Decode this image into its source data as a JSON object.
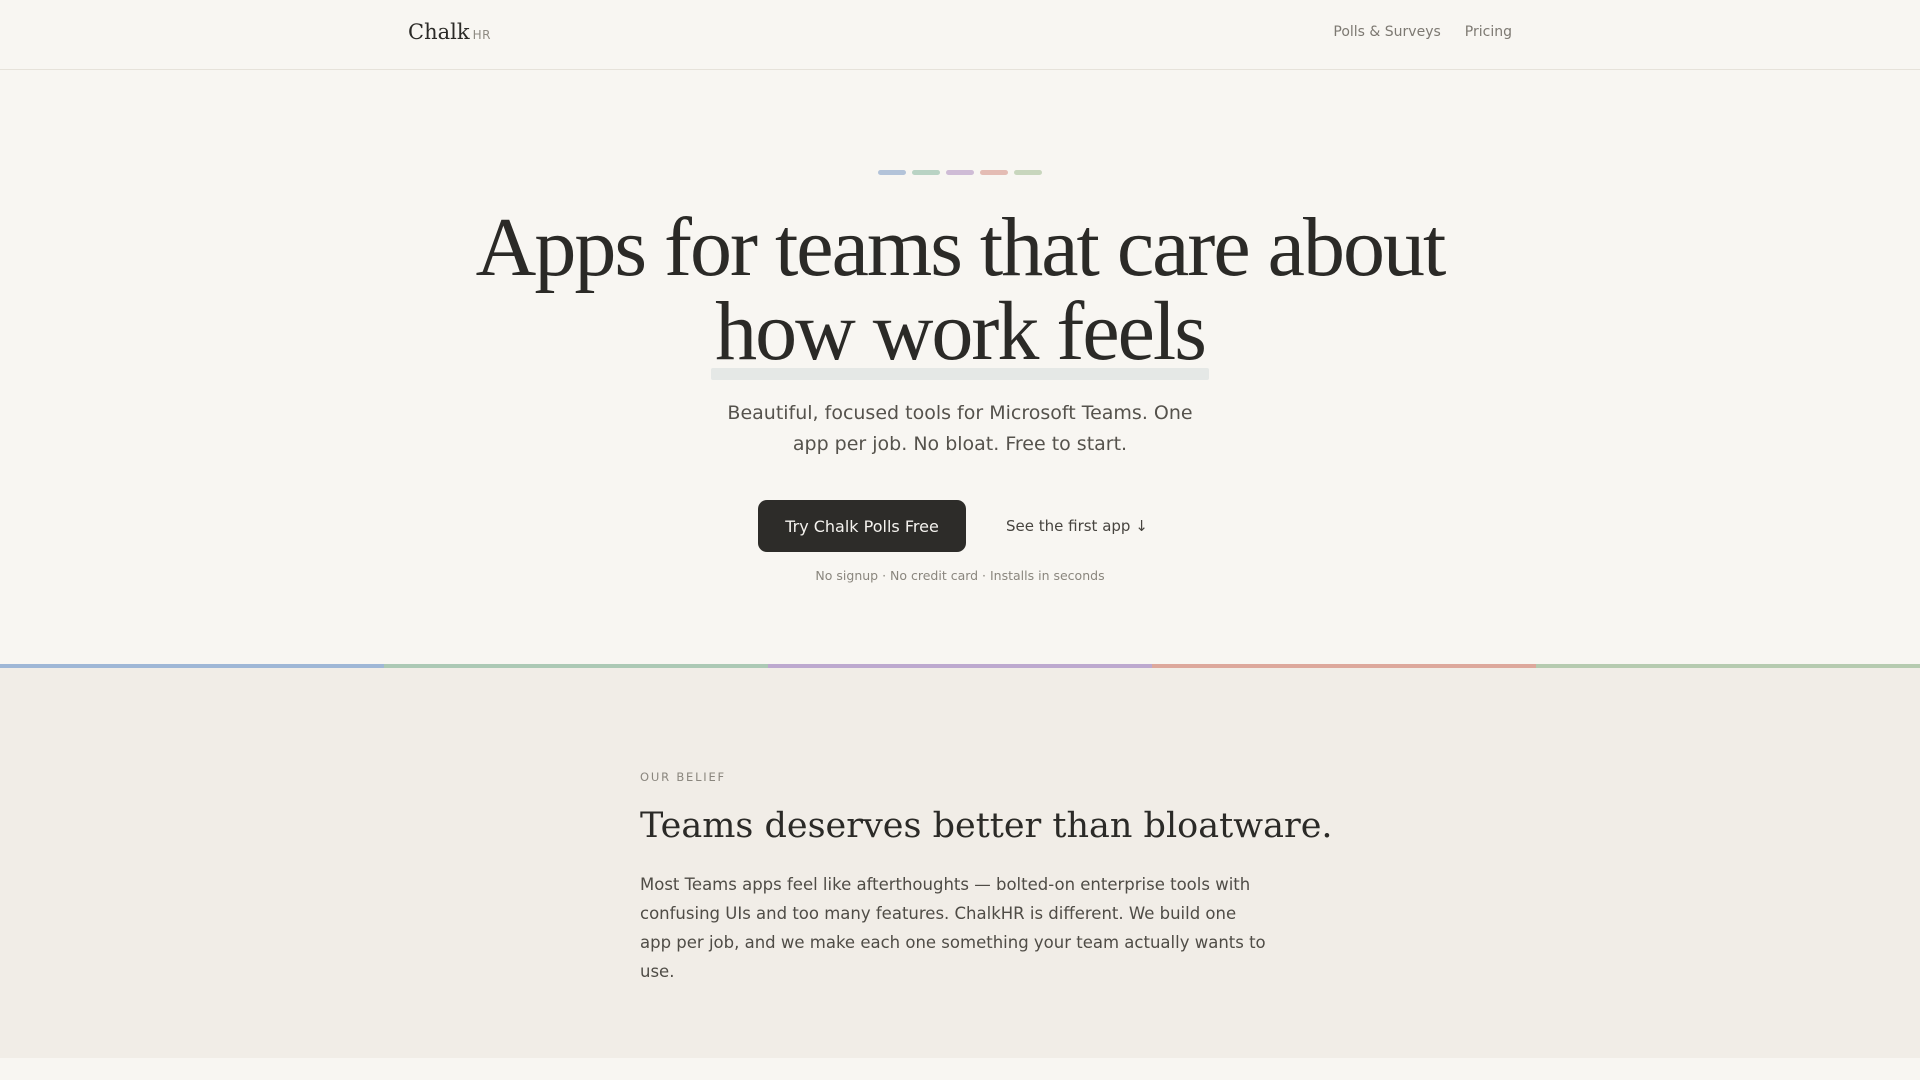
{
  "nav": {
    "brand_name": "Chalk",
    "brand_suffix": "HR",
    "links": [
      "Polls & Surveys",
      "Pricing"
    ]
  },
  "hero": {
    "swatch_colors": [
      "#b3c3d9",
      "#b9d3c4",
      "#cfbcd6",
      "#e4bcb4",
      "#c8d6bd"
    ],
    "headline_line1": "Apps for teams that care about",
    "headline_line2": "how work feels",
    "subhead": "Beautiful, focused tools for Microsoft Teams. One app per job. No bloat. Free to start.",
    "primary_cta": "Try Chalk Polls Free",
    "secondary_cta": "See the first app ↓",
    "fineprint": "No signup · No credit card · Installs in seconds"
  },
  "divider_colors": [
    "#9fb7d6",
    "#acc9b5",
    "#bda9cf",
    "#dda89c",
    "#b6cbb0"
  ],
  "belief": {
    "eyebrow": "OUR BELIEF",
    "title": "Teams deserves better than bloatware.",
    "body": "Most Teams apps feel like afterthoughts — bolted-on enterprise tools with confusing UIs and too many features. ChalkHR is different. We build one app per job, and we make each one something your team actually wants to use."
  }
}
